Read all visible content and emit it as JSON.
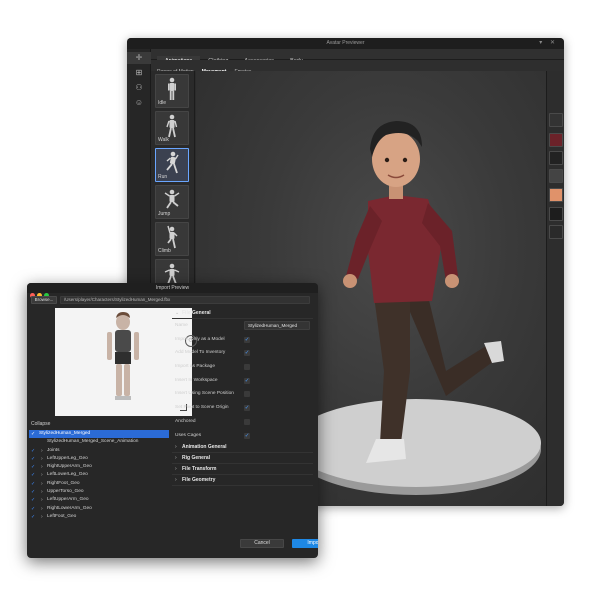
{
  "previewer": {
    "title": "Avatar Previewer",
    "tabs": [
      {
        "label": "Animations"
      },
      {
        "label": "Clothing"
      },
      {
        "label": "Accessories"
      },
      {
        "label": "Body"
      }
    ],
    "subtabs": [
      {
        "label": "Range of Motion"
      },
      {
        "label": "Movement"
      },
      {
        "label": "Emotes"
      }
    ],
    "animations": [
      {
        "label": "Idle"
      },
      {
        "label": "Walk"
      },
      {
        "label": "Run"
      },
      {
        "label": "Jump"
      },
      {
        "label": "Climb"
      },
      {
        "label": ""
      }
    ],
    "left_icons": [
      "move-icon",
      "grid-icon",
      "people-icon",
      "face-icon"
    ],
    "accent_color": "#1e90ff",
    "skin_swatch_color": "#e0926a",
    "shirt_color": "#7a2830",
    "pants_color": "#3a2d26"
  },
  "import_dialog": {
    "title": "Import Preview",
    "browse_label": "Browse...",
    "path": "/Users/player/Characters/StylizedHuman_Merged.fbx",
    "collapse_label": "Collapse",
    "tree": [
      {
        "label": "StylizedHuman_Merged"
      },
      {
        "label": "StylizedHuman_Merged_Scene_Animation"
      },
      {
        "label": "Joints"
      },
      {
        "label": "LeftUpperLeg_Geo"
      },
      {
        "label": "RightUpperArm_Geo"
      },
      {
        "label": "LeftLowerLeg_Geo"
      },
      {
        "label": "RightFoot_Geo"
      },
      {
        "label": "UpperTorso_Geo"
      },
      {
        "label": "LeftUpperArm_Geo"
      },
      {
        "label": "RightLowerArm_Geo"
      },
      {
        "label": "LeftFoot_Geo"
      }
    ],
    "file_general_header": "File General",
    "name_label": "Name",
    "name_value": "StylizedHuman_Merged",
    "properties": [
      {
        "label": "Import Only as a Model",
        "checked": true
      },
      {
        "label": "Add Model To Inventory",
        "checked": true
      },
      {
        "label": "Import as Package",
        "checked": false
      },
      {
        "label": "Insert In Workspace",
        "checked": true
      },
      {
        "label": "Insert Using Scene Position",
        "checked": false
      },
      {
        "label": "Set Pivot to Scene Origin",
        "checked": true
      },
      {
        "label": "Anchored",
        "checked": false
      },
      {
        "label": "Uses Cages",
        "checked": true
      }
    ],
    "sections": [
      {
        "label": "Animation General"
      },
      {
        "label": "Rig General"
      },
      {
        "label": "File Transform"
      },
      {
        "label": "File Geometry"
      }
    ],
    "cancel_label": "Cancel",
    "import_label": "Import",
    "primary_color": "#1e88e5",
    "selection_color": "#2b6bd6"
  }
}
